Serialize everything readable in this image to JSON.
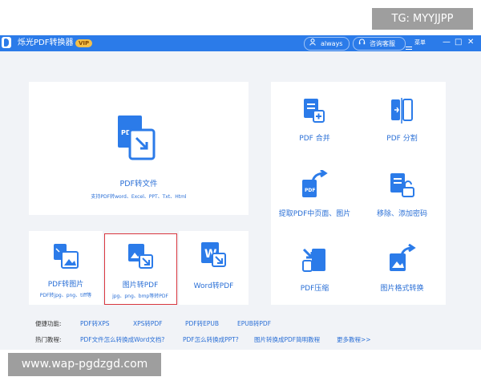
{
  "overlay": {
    "tg_text": "TG: MYYJJPP",
    "watermark_text": "www.wap-pgdzgd.com"
  },
  "titlebar": {
    "app_title": "烁光PDF转换器",
    "vip_label": "VIP",
    "user_label": "always",
    "support_label": "咨询客服",
    "menu_label": "菜单",
    "minimize": "—",
    "maximize": "□",
    "close": "✕"
  },
  "tools": {
    "pdf_to_file": {
      "label": "PDF转文件",
      "sub": "支持PDF转word、Excel、PPT、Txt、Html"
    },
    "pdf_merge": {
      "label": "PDF 合并"
    },
    "pdf_split": {
      "label": "PDF 分割"
    },
    "extract_pages": {
      "label": "提取PDF中页面、图片"
    },
    "password": {
      "label": "移除、添加密码"
    },
    "pdf_to_image": {
      "label": "PDF转图片",
      "sub": "PDF转jpg、png、tiff等"
    },
    "image_to_pdf": {
      "label": "图片转PDF",
      "sub": "jpg、png、bmp等转PDF"
    },
    "word_to_pdf": {
      "label": "Word转PDF"
    },
    "pdf_compress": {
      "label": "PDF压缩"
    },
    "image_convert": {
      "label": "图片格式转换"
    }
  },
  "shortcuts": {
    "label": "便捷功能:",
    "links": [
      "PDF转XPS",
      "XPS转PDF",
      "PDF转EPUB",
      "EPUB转PDF"
    ]
  },
  "tutorials": {
    "label": "热门教程:",
    "links": [
      "PDF文件怎么转换成Word文档?",
      "PDF怎么转换成PPT?",
      "图片转换成PDF简明教程",
      "更多教程>>"
    ]
  },
  "colors": {
    "brand_blue": "#2b7be9",
    "link_blue": "#2a6fd6",
    "highlight_red": "#d9363e",
    "vip_gold": "#f5c04a"
  }
}
